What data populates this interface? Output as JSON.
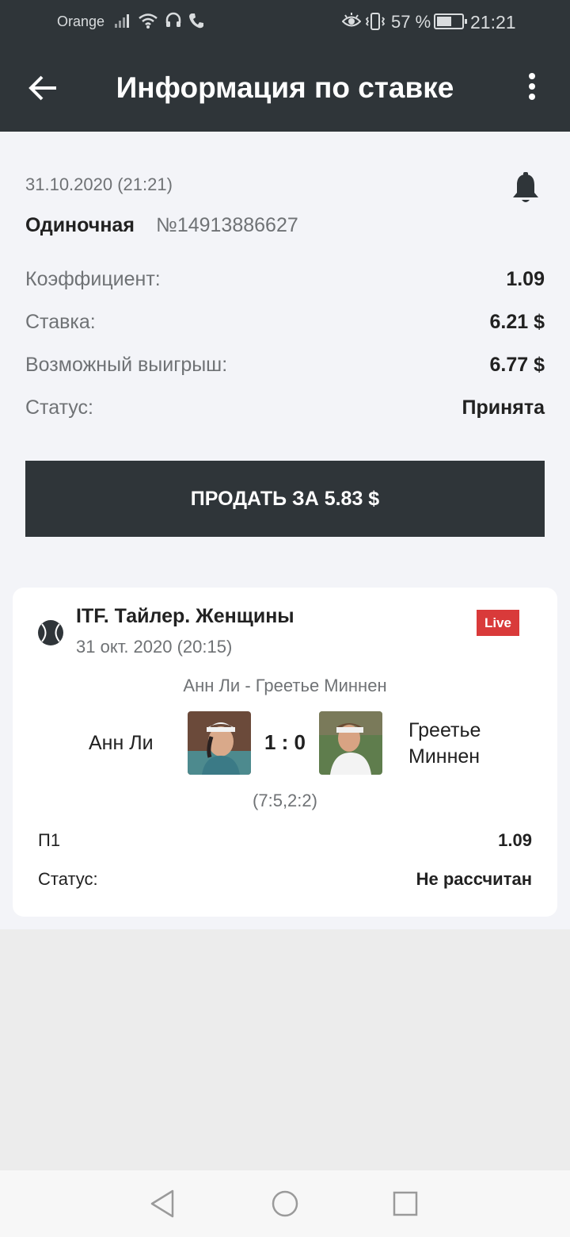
{
  "status_bar": {
    "carrier": "Orange",
    "battery": "57 %",
    "time": "21:21",
    "icons": [
      "signal-icon",
      "wifi-icon",
      "headset-icon",
      "phone-icon",
      "eye-icon",
      "vibrate-icon",
      "battery-icon"
    ]
  },
  "app_bar": {
    "title": "Информация по ставке",
    "back_icon": "arrow-left-icon",
    "menu_icon": "more-vertical-icon"
  },
  "bet": {
    "date": "31.10.2020 (21:21)",
    "type": "Одиночная",
    "number": "№14913886627",
    "rows": [
      {
        "label": "Коэффициент:",
        "value": "1.09"
      },
      {
        "label": "Ставка:",
        "value": "6.21 $"
      },
      {
        "label": "Возможный выигрыш:",
        "value": "6.77 $"
      },
      {
        "label": "Статус:",
        "value": "Принята"
      }
    ],
    "sell_button": "ПРОДАТЬ ЗА 5.83 $"
  },
  "event": {
    "league": "ITF. Тайлер. Женщины",
    "date": "31 окт. 2020 (20:15)",
    "live_badge": "Live",
    "match": "Анн Ли - Греетье Миннен",
    "team1": "Анн Ли",
    "team2": "Греетье Миннен",
    "score": "1 : 0",
    "sets": "(7:5,2:2)",
    "outcome": {
      "label": "П1",
      "value": "1.09"
    },
    "status": {
      "label": "Статус:",
      "value": "Не рассчитан"
    }
  },
  "colors": {
    "header": "#2f3539",
    "content_bg": "#f3f4f8",
    "live_badge": "#d93a3a",
    "muted_text": "#6f7275"
  }
}
